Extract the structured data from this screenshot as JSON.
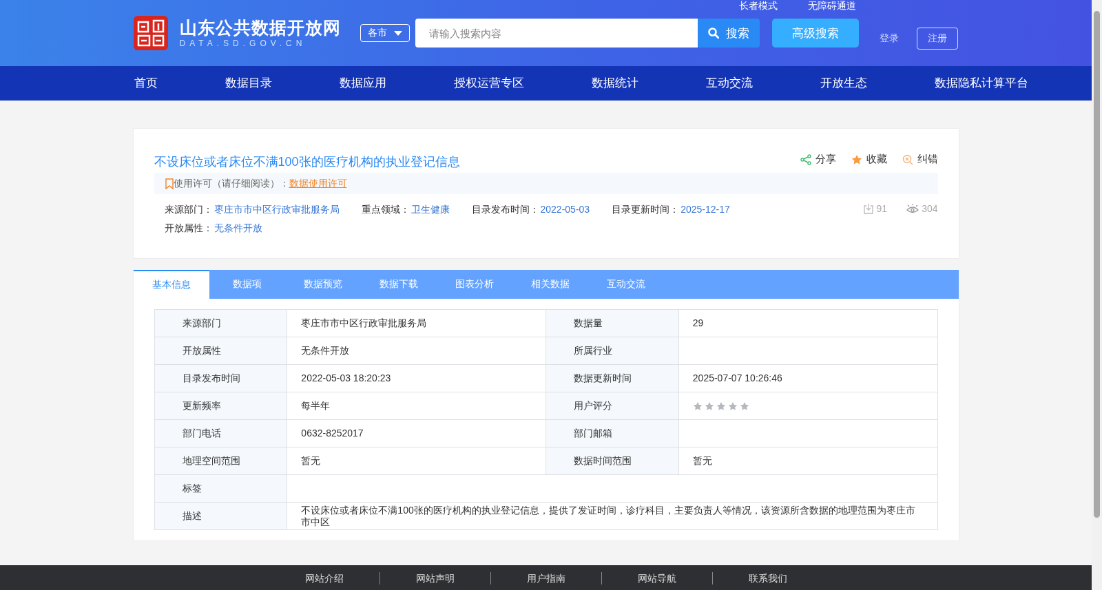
{
  "header": {
    "logo_title": "山东公共数据开放网",
    "logo_subtitle": "DATA.SD.GOV.CN",
    "top_links": [
      "长者模式",
      "无障碍通道"
    ],
    "city_select": "各市",
    "search": {
      "placeholder": "请输入搜索内容",
      "button": "搜索"
    },
    "advanced_search": "高级搜索",
    "login": "登录",
    "register": "注册"
  },
  "nav": [
    {
      "label": "首页",
      "selected": false
    },
    {
      "label": "数据目录",
      "selected": false
    },
    {
      "label": "数据应用",
      "selected": false
    },
    {
      "label": "授权运营专区",
      "selected": false
    },
    {
      "label": "数据统计",
      "selected": false
    },
    {
      "label": "互动交流",
      "selected": false
    },
    {
      "label": "开放生态",
      "selected": false
    },
    {
      "label": "数据隐私计算平台",
      "selected": false
    }
  ],
  "dataset": {
    "title": "不设床位或者床位不满100张的医疗机构的执业登记信息",
    "license_label": "使用许可（请仔细阅读）：",
    "license_link": "数据使用许可",
    "actions": [
      {
        "kind": "share",
        "label": "分享"
      },
      {
        "kind": "favorite",
        "label": "收藏"
      },
      {
        "kind": "report",
        "label": "纠错"
      }
    ],
    "meta": [
      [
        {
          "label": "来源部门：",
          "value": "枣庄市市中区行政审批服务局"
        },
        {
          "label": "重点领域：",
          "value": "卫生健康"
        },
        {
          "label": "目录发布时间：",
          "value": "2022-05-03"
        },
        {
          "label": "目录更新时间：",
          "value": "2025-12-17"
        }
      ],
      [
        {
          "label": "开放属性：",
          "value": "无条件开放"
        }
      ]
    ],
    "downloads": "91",
    "views": "304"
  },
  "tabs": [
    {
      "label": "基本信息",
      "selected": true
    },
    {
      "label": "数据项",
      "selected": false
    },
    {
      "label": "数据预览",
      "selected": false
    },
    {
      "label": "数据下载",
      "selected": false
    },
    {
      "label": "图表分析",
      "selected": false
    },
    {
      "label": "相关数据",
      "selected": false
    },
    {
      "label": "互动交流",
      "selected": false
    }
  ],
  "info_table": {
    "rows": [
      {
        "cells": [
          {
            "label": "来源部门",
            "value": "枣庄市市中区行政审批服务局"
          },
          {
            "label": "数据量",
            "value": "29"
          }
        ]
      },
      {
        "cells": [
          {
            "label": "开放属性",
            "value": "无条件开放"
          },
          {
            "label": "所属行业"
          }
        ]
      },
      {
        "cells": [
          {
            "label": "目录发布时间",
            "value": "2022-05-03 18:20:23"
          },
          {
            "label": "数据更新时间",
            "value": "2025-07-07 10:26:46"
          }
        ]
      },
      {
        "cells": [
          {
            "label": "更新频率",
            "value": "每半年"
          },
          {
            "label": "用户评分",
            "kind": "rating",
            "stars": 0
          }
        ]
      },
      {
        "cells": [
          {
            "label": "部门电话",
            "value": "0632-8252017"
          },
          {
            "label": "部门邮箱"
          }
        ]
      },
      {
        "cells": [
          {
            "label": "地理空间范围",
            "value": "暂无"
          },
          {
            "label": "数据时间范围",
            "value": "暂无"
          }
        ]
      },
      {
        "cells": [
          {
            "label": "标签"
          }
        ]
      },
      {
        "cells": [
          {
            "label": "描述",
            "value": "不设床位或者床位不满100张的医疗机构的执业登记信息，提供了发证时间，诊疗科目，主要负责人等情况，该资源所含数据的地理范围为枣庄市市中区"
          }
        ]
      }
    ]
  },
  "footer": {
    "links": [
      "网站介绍",
      "网站声明",
      "用户指南",
      "网站导航",
      "联系我们"
    ]
  }
}
